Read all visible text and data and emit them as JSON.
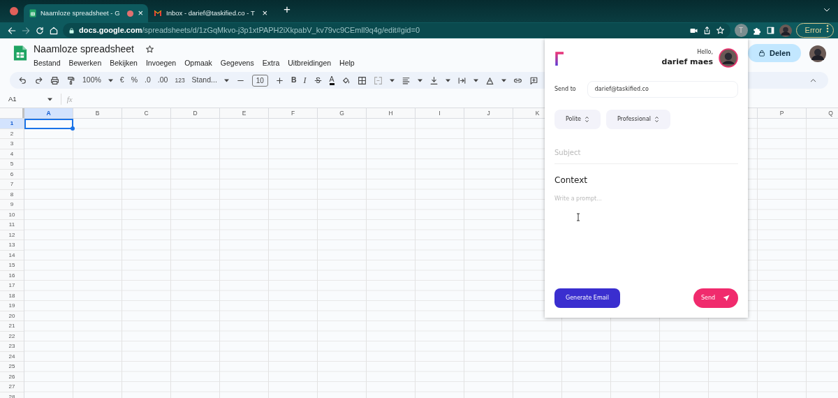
{
  "browser": {
    "tabs": [
      {
        "title": "Naamloze spreadsheet - G",
        "selected": true,
        "close": "×"
      },
      {
        "title": "Inbox - darief@taskified.co - T",
        "selected": false,
        "close": "×"
      }
    ],
    "new_tab": "+",
    "url_host": "docs.google.com",
    "url_path": "/spreadsheets/d/1zGqMkvo-j3p1xtPAPH2iXkpabV_kv79vc9CEmll9q4g/edit#gid=0",
    "extension_letter": "T",
    "profile_status": "Error"
  },
  "sheets": {
    "title": "Naamloze spreadsheet",
    "menu": [
      "Bestand",
      "Bewerken",
      "Bekijken",
      "Invoegen",
      "Opmaak",
      "Gegevens",
      "Extra",
      "Uitbreidingen",
      "Help"
    ],
    "share_button": "Delen",
    "toolbar": {
      "zoom": "100%",
      "currency": "€",
      "percent": "%",
      "decrease_decimals": ".0",
      "increase_decimals": ".00",
      "number_format": "123",
      "font": "Stand...",
      "font_size": "10",
      "bold": "B",
      "italic": "I",
      "text_color": "A"
    },
    "name_box": "A1",
    "formula_label": "fx",
    "columns_left": [
      {
        "label": "A",
        "selected": true
      },
      {
        "label": "B",
        "selected": false
      },
      {
        "label": "C",
        "selected": false
      },
      {
        "label": "D",
        "selected": false
      },
      {
        "label": "E",
        "selected": false
      },
      {
        "label": "F",
        "selected": false
      },
      {
        "label": "G",
        "selected": false
      },
      {
        "label": "H",
        "selected": false
      },
      {
        "label": "I",
        "selected": false
      },
      {
        "label": "J",
        "selected": false
      },
      {
        "label": "K",
        "selected": false
      }
    ],
    "columns_right": [
      {
        "label": "P",
        "selected": false
      },
      {
        "label": "Q",
        "selected": false
      }
    ],
    "rows": [
      {
        "label": "1",
        "selected": true
      },
      {
        "label": "2",
        "selected": false
      },
      {
        "label": "3",
        "selected": false
      },
      {
        "label": "4",
        "selected": false
      },
      {
        "label": "5",
        "selected": false
      },
      {
        "label": "6",
        "selected": false
      },
      {
        "label": "7",
        "selected": false
      },
      {
        "label": "8",
        "selected": false
      },
      {
        "label": "9",
        "selected": false
      },
      {
        "label": "10",
        "selected": false
      },
      {
        "label": "11",
        "selected": false
      },
      {
        "label": "12",
        "selected": false
      },
      {
        "label": "13",
        "selected": false
      },
      {
        "label": "14",
        "selected": false
      },
      {
        "label": "15",
        "selected": false
      },
      {
        "label": "16",
        "selected": false
      },
      {
        "label": "17",
        "selected": false
      },
      {
        "label": "18",
        "selected": false
      },
      {
        "label": "19",
        "selected": false
      },
      {
        "label": "20",
        "selected": false
      },
      {
        "label": "21",
        "selected": false
      },
      {
        "label": "22",
        "selected": false
      },
      {
        "label": "23",
        "selected": false
      },
      {
        "label": "24",
        "selected": false
      },
      {
        "label": "25",
        "selected": false
      },
      {
        "label": "26",
        "selected": false
      },
      {
        "label": "27",
        "selected": false
      },
      {
        "label": "28",
        "selected": false
      }
    ]
  },
  "popup": {
    "greeting": "Hello,",
    "user_name": "darief maes",
    "send_to_label": "Send to",
    "send_to_value": "darief@taskified.co",
    "tones": [
      {
        "label": "Polite"
      },
      {
        "label": "Professional"
      }
    ],
    "subject_placeholder": "Subject",
    "context_heading": "Context",
    "prompt_placeholder": "Write a prompt...",
    "generate_button": "Generate Email",
    "send_button": "Send"
  }
}
